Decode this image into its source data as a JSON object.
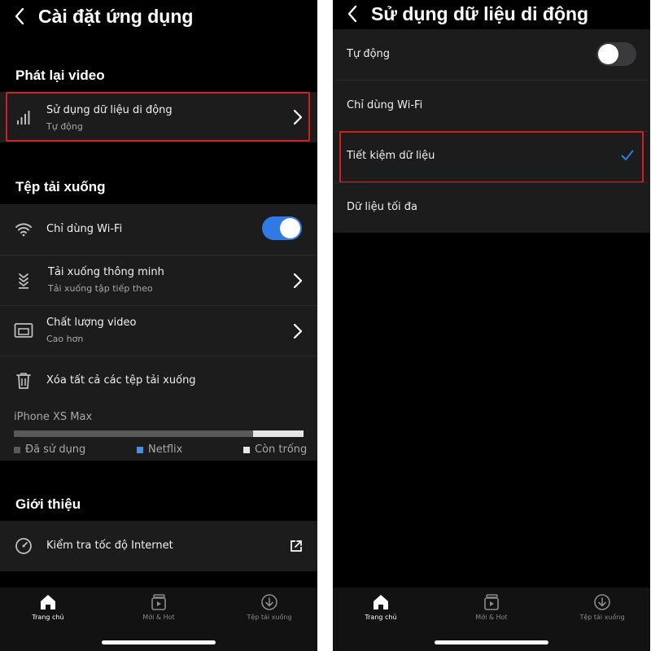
{
  "left": {
    "title": "Cài đặt ứng dụng",
    "sections": {
      "playback": "Phát lại video",
      "downloads": "Tệp tải xuống",
      "about": "Giới thiệu"
    },
    "mobile_data": {
      "label": "Sử dụng dữ liệu di động",
      "value": "Tự động"
    },
    "wifi_only": {
      "label": "Chỉ dùng Wi-Fi",
      "enabled": true
    },
    "smart_downloads": {
      "label": "Tải xuống thông minh",
      "value": "Tải xuống tập tiếp theo"
    },
    "video_quality": {
      "label": "Chất lượng video",
      "value": "Cao hơn"
    },
    "delete_all": {
      "label": "Xóa tất cả các tệp tải xuống"
    },
    "storage": {
      "device": "iPhone XS Max",
      "used_fraction": 0.825,
      "legend": [
        "Đã sử dụng",
        "Netflix",
        "Còn trống"
      ],
      "legend_colors": [
        "#5a5a5a",
        "#4a90e2",
        "#e6e6e6"
      ]
    },
    "speed_test": {
      "label": "Kiểm tra tốc độ Internet"
    }
  },
  "right": {
    "title": "Sử dụng dữ liệu di động",
    "options": [
      {
        "label": "Tự động",
        "control": "toggle-off"
      },
      {
        "label": "Chỉ dùng Wi-Fi"
      },
      {
        "label": "Tiết kiệm dữ liệu",
        "selected": true
      },
      {
        "label": "Dữ liệu tối đa"
      }
    ]
  },
  "tabs": [
    {
      "label": "Trang chủ",
      "icon": "home-icon",
      "active": true
    },
    {
      "label": "Mới & Hot",
      "icon": "new-hot-icon",
      "active": false
    },
    {
      "label": "Tệp tải xuống",
      "icon": "download-icon",
      "active": false
    }
  ],
  "colors": {
    "accent_blue": "#2f7ae5",
    "highlight_red": "#d3201f",
    "background": "#000000",
    "row_bg": "#1c1c1c",
    "toggle_off": "#3a3a3c"
  }
}
